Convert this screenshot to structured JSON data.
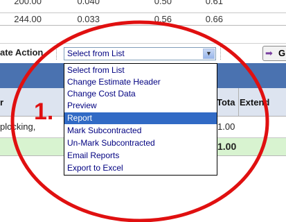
{
  "top_rows": [
    [
      "200.00",
      "0.040",
      "0.50",
      "0.61"
    ],
    [
      "244.00",
      "0.033",
      "0.56",
      "0.66"
    ]
  ],
  "action": {
    "label": "ate Action",
    "selected": "Select from List",
    "go_label": "G"
  },
  "columns": [
    "r",
    "Tota",
    "Extend"
  ],
  "data_row": [
    "plocking,",
    "1.00"
  ],
  "total_row": [
    "1.00"
  ],
  "dropdown": {
    "items": [
      "Select from List",
      "Change Estimate Header",
      "Change Cost Data",
      "Preview",
      "Report",
      "Mark Subcontracted",
      "Un-Mark Subcontracted",
      "Email Reports",
      "Export to Excel"
    ],
    "highlighted": "Report"
  },
  "annotation": {
    "label": "1."
  },
  "colors": {
    "highlight": "#316ac5",
    "annotation": "#e01010",
    "total_row": "#d8f3d0",
    "header_band": "#4a72b0"
  }
}
